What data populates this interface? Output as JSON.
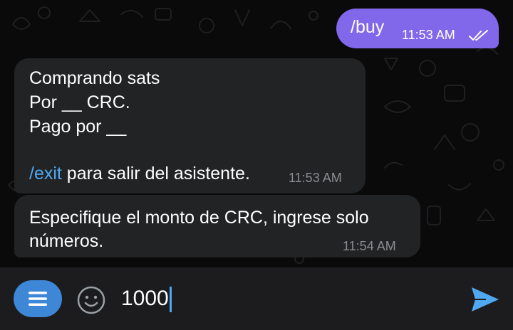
{
  "messages": [
    {
      "direction": "outgoing",
      "text": "/buy",
      "time": "11:53 AM",
      "status_icon": "double-check-icon"
    },
    {
      "direction": "incoming",
      "lines": [
        "Comprando sats",
        "Por __ CRC.",
        "Pago por __",
        ""
      ],
      "command": "/exit",
      "command_suffix": " para salir del asistente.",
      "time": "11:53 AM"
    },
    {
      "direction": "incoming",
      "lines": [
        "Especifique el monto de CRC, ingrese solo",
        "números."
      ],
      "time": "11:54 AM"
    }
  ],
  "composer": {
    "menu_icon": "menu-icon",
    "emoji_icon": "smiley-icon",
    "input_value": "1000",
    "send_icon": "send-icon"
  },
  "colors": {
    "chat_background": "#0a0a0a",
    "outgoing_bubble": "#8167e9",
    "incoming_bubble": "#222325",
    "link": "#4fa8f0",
    "menu_button": "#3e86d6",
    "composer_background": "#1c1c1e",
    "send_icon": "#4fa8f0"
  }
}
